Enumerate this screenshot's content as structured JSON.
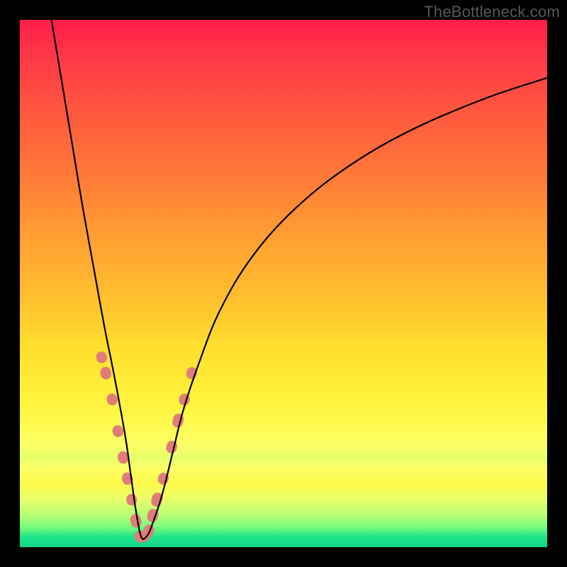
{
  "watermark": "TheBottleneck.com",
  "colors": {
    "frame": "#000000",
    "curve": "#000000",
    "bead": "#e07d78"
  },
  "chart_data": {
    "type": "line",
    "title": "",
    "xlabel": "",
    "ylabel": "",
    "xlim": [
      0,
      100
    ],
    "ylim": [
      0,
      100
    ],
    "grid": false,
    "legend": false,
    "note": "V-shaped bottleneck curve; y estimated as percentage height (100=top, 0=bottom). Minimum near x≈23.",
    "series": [
      {
        "name": "bottleneck-curve",
        "x": [
          6,
          8,
          10,
          12,
          14,
          16,
          18,
          20,
          21,
          22,
          23,
          24,
          25,
          27,
          29,
          31,
          34,
          38,
          44,
          52,
          62,
          74,
          88,
          100
        ],
        "y": [
          100,
          88,
          76,
          64,
          53,
          42,
          32,
          21,
          14,
          7,
          2,
          2,
          4,
          10,
          18,
          26,
          35,
          45,
          55,
          64,
          72,
          79,
          85,
          89
        ]
      }
    ],
    "beads": {
      "description": "pink rounded markers along the curve near the valley",
      "points_x": [
        15.5,
        16.3,
        17.5,
        18.6,
        19.6,
        20.4,
        21.2,
        22.0,
        22.8,
        23.6,
        24.4,
        25.2,
        26.0,
        27.2,
        28.8,
        30.0,
        31.2,
        32.6
      ],
      "points_y": [
        36,
        33,
        28,
        22,
        17,
        13,
        9,
        5,
        2,
        2,
        3,
        6,
        9,
        13,
        19,
        24,
        28,
        33
      ]
    }
  }
}
